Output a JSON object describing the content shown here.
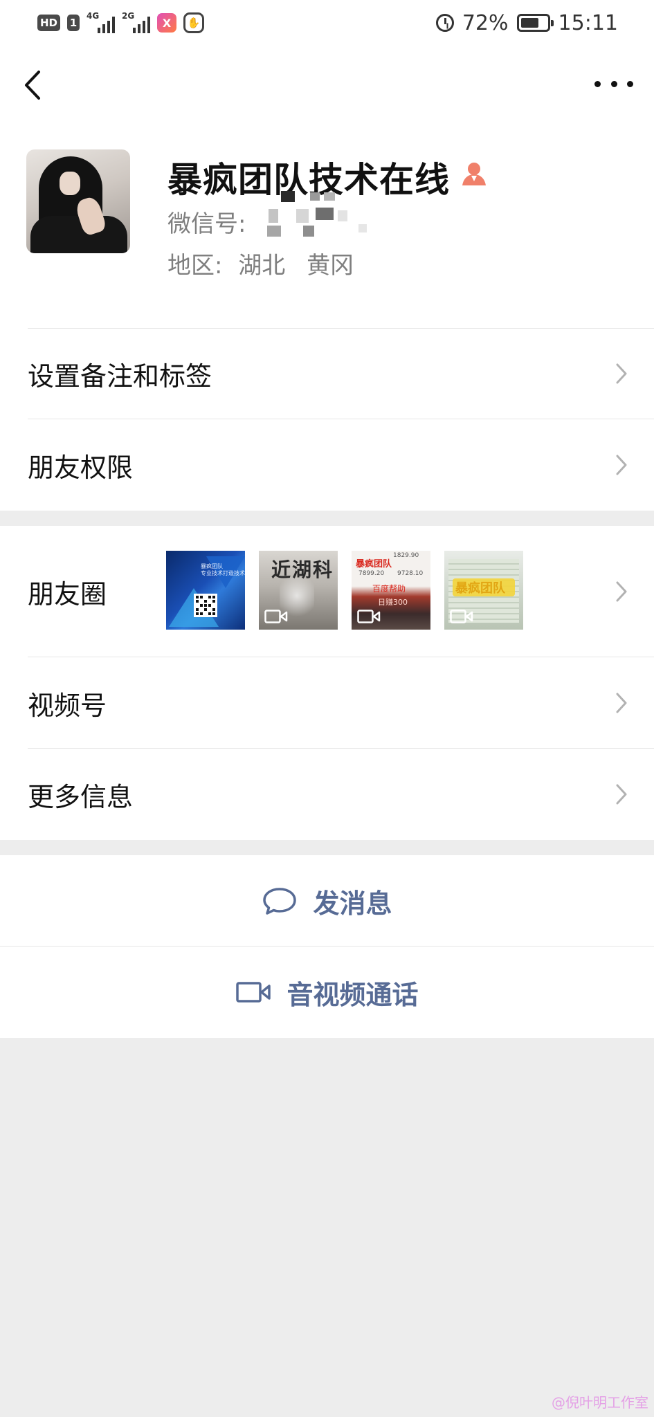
{
  "status_bar": {
    "hd_badge": "HD",
    "sim_badge": "1",
    "net1": "4G",
    "net2": "2G",
    "app_icon": "X",
    "battery": "72%",
    "time": "15:11",
    "icons": [
      "alarm-icon",
      "battery-icon",
      "signal-icon",
      "hand-icon"
    ]
  },
  "nav": {
    "back_icon": "chevron-left-icon",
    "more_icon": "more-dots-icon"
  },
  "profile": {
    "name": "暴疯团队技术在线",
    "name_icon": "person-icon",
    "wechat_id_label": "微信号:",
    "region_label": "地区:",
    "region_province": "湖北",
    "region_city": "黄冈"
  },
  "menu_group_1": [
    {
      "label": "设置备注和标签"
    },
    {
      "label": "朋友权限"
    }
  ],
  "moments": {
    "label": "朋友圈",
    "thumbs": [
      {
        "kind": "image",
        "caption_line1": "暴疯团队",
        "caption_line2": "专业技术打造技术指导"
      },
      {
        "kind": "video",
        "sign": "近湖科"
      },
      {
        "kind": "video",
        "title": "暴疯团队",
        "n1": "1829.90",
        "n2": "7899.20",
        "n3": "9728.10",
        "cn": "百度帮助",
        "pay": "日赚300"
      },
      {
        "kind": "video",
        "band": "暴疯团队"
      }
    ]
  },
  "menu_group_2": [
    {
      "label": "视频号"
    },
    {
      "label": "更多信息"
    }
  ],
  "actions": {
    "message": "发消息",
    "call": "音视频通话"
  },
  "watermark": "@倪叶明工作室",
  "colors": {
    "accent": "#576b95",
    "background": "#ededed",
    "card": "#ffffff",
    "person_icon": "#f0806a"
  }
}
